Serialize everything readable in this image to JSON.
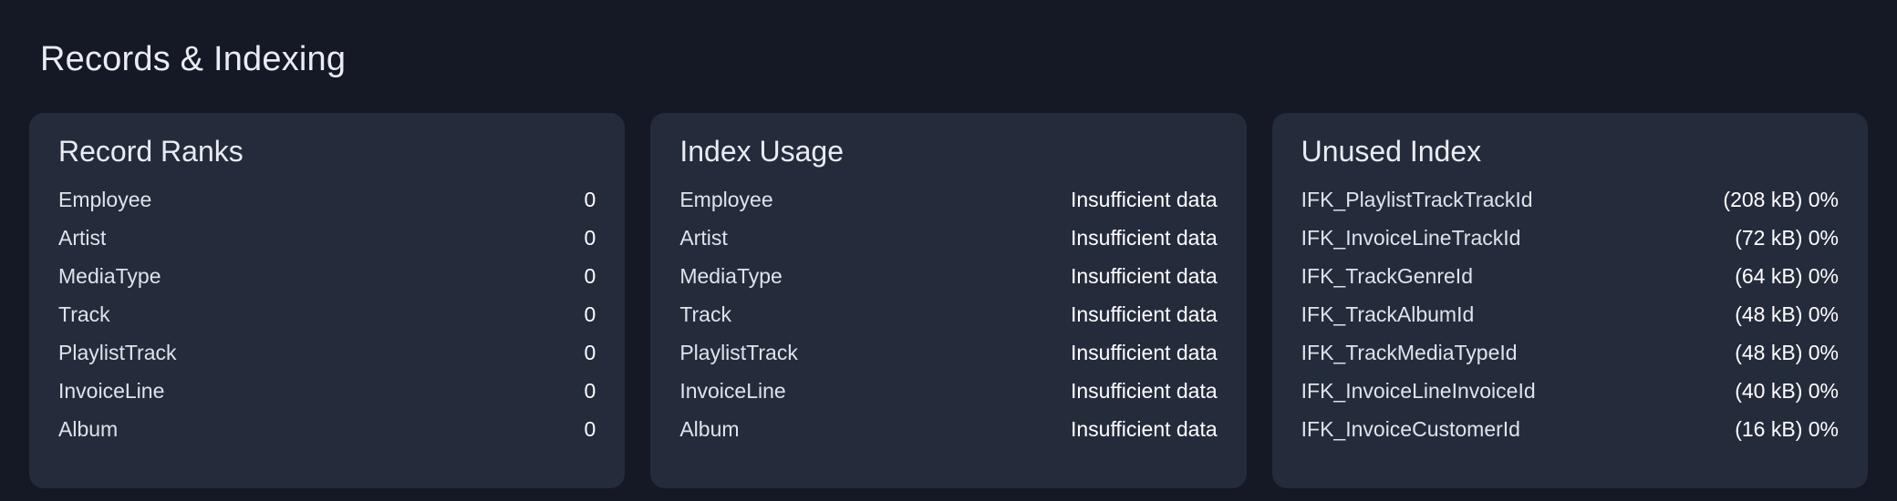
{
  "page": {
    "title": "Records & Indexing",
    "background_color": "#141925",
    "card_color": "#242c3c",
    "text_color": "#e9ecf2"
  },
  "cards": [
    {
      "title": "Record Ranks",
      "rows": [
        {
          "label": "Employee",
          "value": "0"
        },
        {
          "label": "Artist",
          "value": "0"
        },
        {
          "label": "MediaType",
          "value": "0"
        },
        {
          "label": "Track",
          "value": "0"
        },
        {
          "label": "PlaylistTrack",
          "value": "0"
        },
        {
          "label": "InvoiceLine",
          "value": "0"
        },
        {
          "label": "Album",
          "value": "0"
        }
      ]
    },
    {
      "title": "Index Usage",
      "rows": [
        {
          "label": "Employee",
          "value": "Insufficient data"
        },
        {
          "label": "Artist",
          "value": "Insufficient data"
        },
        {
          "label": "MediaType",
          "value": "Insufficient data"
        },
        {
          "label": "Track",
          "value": "Insufficient data"
        },
        {
          "label": "PlaylistTrack",
          "value": "Insufficient data"
        },
        {
          "label": "InvoiceLine",
          "value": "Insufficient data"
        },
        {
          "label": "Album",
          "value": "Insufficient data"
        }
      ]
    },
    {
      "title": "Unused Index",
      "rows": [
        {
          "label": "IFK_PlaylistTrackTrackId",
          "value": "(208 kB) 0%"
        },
        {
          "label": "IFK_InvoiceLineTrackId",
          "value": "(72 kB) 0%"
        },
        {
          "label": "IFK_TrackGenreId",
          "value": "(64 kB) 0%"
        },
        {
          "label": "IFK_TrackAlbumId",
          "value": "(48 kB) 0%"
        },
        {
          "label": "IFK_TrackMediaTypeId",
          "value": "(48 kB) 0%"
        },
        {
          "label": "IFK_InvoiceLineInvoiceId",
          "value": "(40 kB) 0%"
        },
        {
          "label": "IFK_InvoiceCustomerId",
          "value": "(16 kB) 0%"
        }
      ]
    }
  ]
}
